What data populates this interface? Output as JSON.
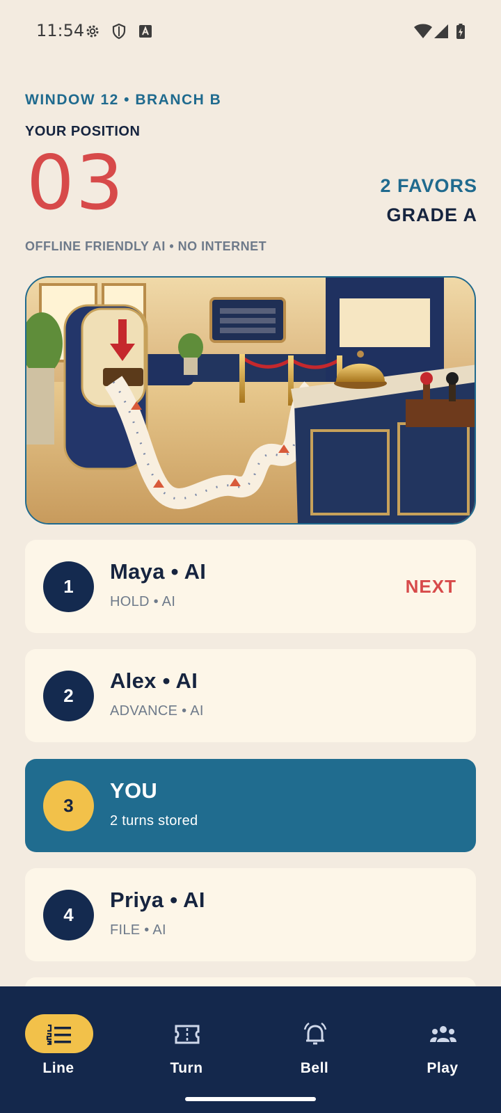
{
  "status": {
    "time": "11:54"
  },
  "header": {
    "window_line": "WINDOW 12 • BRANCH B",
    "position_label": "YOUR POSITION",
    "position_number": "03",
    "favors": "2 FAVORS",
    "grade": "GRADE A",
    "mode_note": "OFFLINE FRIENDLY AI • NO INTERNET"
  },
  "queue": [
    {
      "number": "1",
      "name": "Maya • AI",
      "sub": "HOLD • AI",
      "badge": "NEXT"
    },
    {
      "number": "2",
      "name": "Alex • AI",
      "sub": "ADVANCE • AI"
    },
    {
      "number": "3",
      "name": "YOU",
      "sub": "2 turns stored",
      "is_you": true
    },
    {
      "number": "4",
      "name": "Priya • AI",
      "sub": "FILE • AI"
    }
  ],
  "nav": [
    {
      "label": "Line",
      "icon": "list-numbered-icon",
      "active": true
    },
    {
      "label": "Turn",
      "icon": "ticket-icon"
    },
    {
      "label": "Bell",
      "icon": "bell-icon"
    },
    {
      "label": "Play",
      "icon": "group-icon"
    }
  ],
  "colors": {
    "background": "#f3ebe0",
    "accent_blue": "#1f6a8e",
    "accent_red": "#d74a4a",
    "navy": "#14284c",
    "gold": "#f2c14a",
    "card": "#fdf6e8"
  }
}
